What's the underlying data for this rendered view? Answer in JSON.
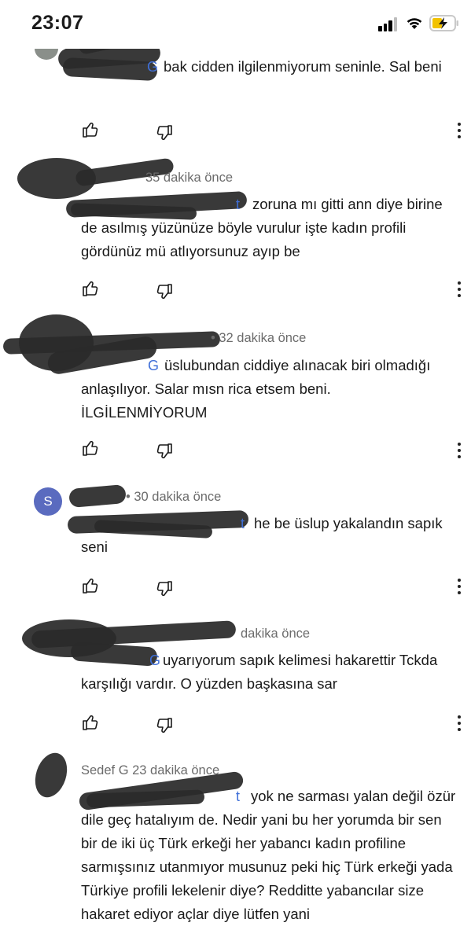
{
  "status": {
    "time": "23:07"
  },
  "comments": [
    {
      "meta": "",
      "mention": "G",
      "text": "bak cidden ilgilenmiyorum seninle. Sal beni"
    },
    {
      "meta": "35 dakika önce",
      "mention": "t",
      "text": "zoruna mı gitti ann diye birine de asılmış yüzünüze böyle vurulur işte kadın profili gördünüz mü atlıyorsunuz ayıp be"
    },
    {
      "meta": "• 32 dakika önce",
      "mention": "G",
      "text": "üslubundan ciddiye alınacak biri olmadığı anlaşılıyor. Salar mısn rica etsem beni. İLGİLENMİYORUM"
    },
    {
      "avatar_letter": "S",
      "meta": "• 30 dakika önce",
      "mention": "t",
      "text": "he be üslup yakalandın sapık seni"
    },
    {
      "meta": "dakika önce",
      "mention": "G",
      "text": "uyarıyorum sapık kelimesi hakarettir Tckda karşılığı vardır. O yüzden başkasına sar"
    },
    {
      "meta": "Sedef G 23 dakika önce",
      "mention": "t",
      "text": "yok ne sarması yalan değil özür dile geç hatalıyım de. Nedir yani bu her yorumda bir sen bir de iki üç Türk erkeği her yabancı kadın profiline sarmışsınız utanmıyor musunuz peki hiç Türk erkeği yada Türkiye profili lekelenir diye? Redditte yabancılar size hakaret ediyor açlar diye lütfen yani"
    }
  ],
  "icons": {
    "like": "thumb-up-icon",
    "dislike": "thumb-down-icon",
    "more": "more-vertical-icon"
  },
  "colors": {
    "mention": "#3f6fd8",
    "meta": "#6b6b6b",
    "avatar_s": "#5a6bbf",
    "redaction": "#2a2a2a"
  }
}
